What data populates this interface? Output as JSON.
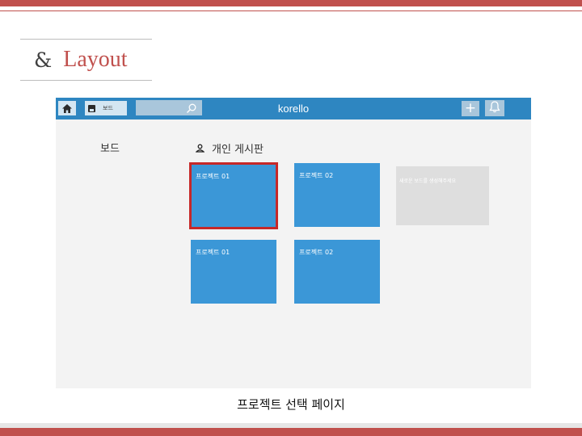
{
  "slide": {
    "section_amp": "&",
    "section_word": "Layout",
    "caption": "프로젝트 선택 페이지"
  },
  "appbar": {
    "title": "korello",
    "board_button_label": "보드",
    "search_placeholder": "",
    "plus_label": "+"
  },
  "sidebar": {
    "heading": "보드"
  },
  "main": {
    "personal_heading": "개인 게시판",
    "cards": [
      {
        "label": "프로젝트 01",
        "selected": true
      },
      {
        "label": "프로젝트 02",
        "selected": false
      },
      {
        "label": "프로젝트 01",
        "selected": false
      },
      {
        "label": "프로젝트 02",
        "selected": false
      }
    ],
    "new_board_hint": "새로운 보드를 생성해주세요"
  },
  "colors": {
    "accent_red": "#c0504d",
    "appbar_blue": "#2e86c1",
    "card_blue": "#3b97d7",
    "selection_red": "#c62828"
  },
  "icons": [
    "home-icon",
    "save-icon",
    "search-icon",
    "plus-icon",
    "bell-icon",
    "user-icon"
  ]
}
